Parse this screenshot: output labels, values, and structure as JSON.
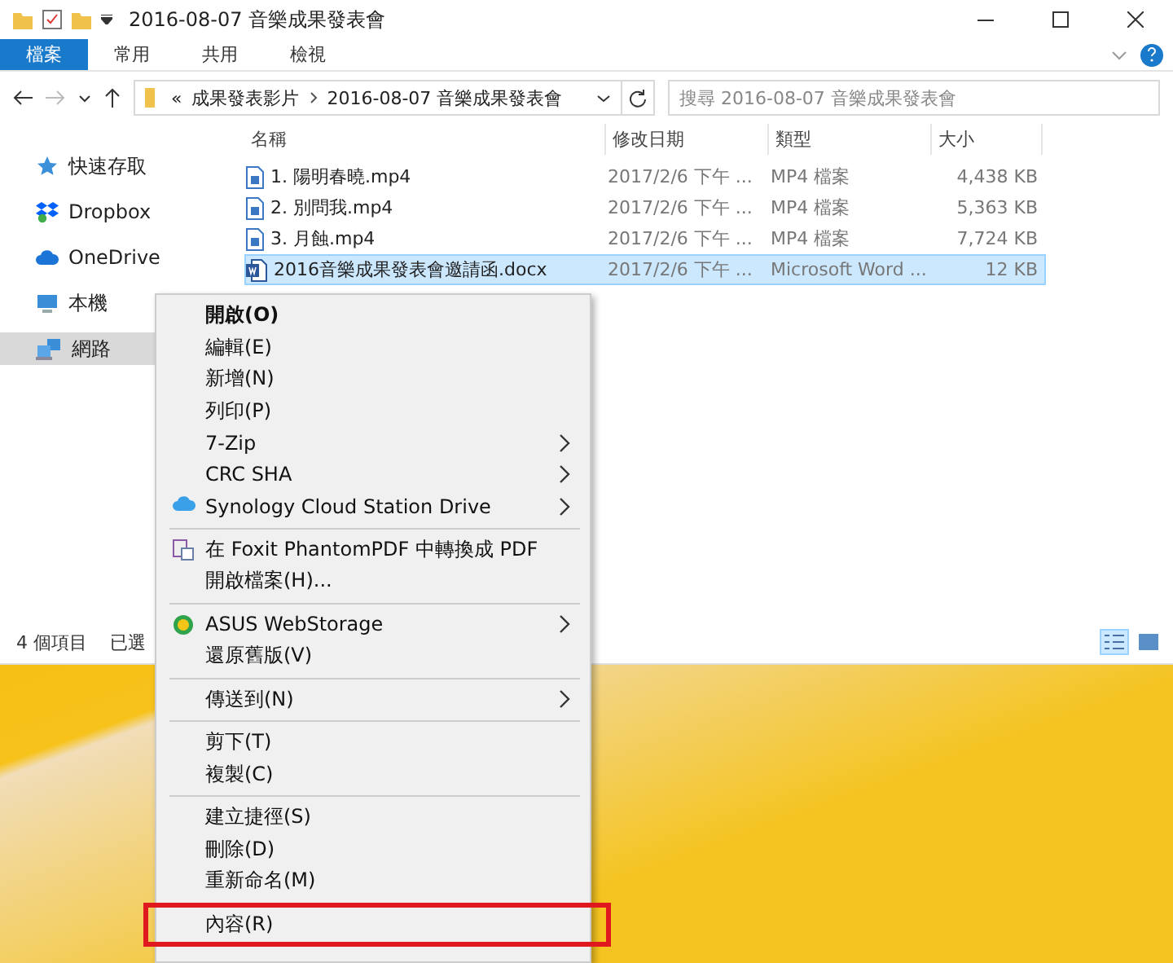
{
  "window": {
    "title": "2016-08-07 音樂成果發表會"
  },
  "ribbon_tabs": [
    {
      "label": "檔案",
      "selected": true
    },
    {
      "label": "常用",
      "selected": false
    },
    {
      "label": "共用",
      "selected": false
    },
    {
      "label": "檢視",
      "selected": false
    }
  ],
  "address": {
    "overflow": "«",
    "crumbs": [
      "成果發表影片",
      "2016-08-07 音樂成果發表會"
    ]
  },
  "search": {
    "placeholder": "搜尋 2016-08-07 音樂成果發表會"
  },
  "sidebar": {
    "items": [
      {
        "label": "快速存取",
        "kind": "star",
        "selected": false
      },
      {
        "label": "Dropbox",
        "kind": "box",
        "selected": false
      },
      {
        "label": "OneDrive",
        "kind": "cloud",
        "selected": false
      },
      {
        "label": "本機",
        "kind": "computer",
        "selected": false
      },
      {
        "label": "網路",
        "kind": "network",
        "selected": true
      }
    ]
  },
  "table": {
    "columns": [
      "名稱",
      "修改日期",
      "類型",
      "大小"
    ],
    "rows": [
      {
        "name": "1. 陽明春曉.mp4",
        "date": "2017/2/6 下午 ...",
        "type": "MP4 檔案",
        "size": "4,438 KB",
        "kind": "video",
        "selected": false
      },
      {
        "name": "2. 別問我.mp4",
        "date": "2017/2/6 下午 ...",
        "type": "MP4 檔案",
        "size": "5,363 KB",
        "kind": "video",
        "selected": false
      },
      {
        "name": "3. 月蝕.mp4",
        "date": "2017/2/6 下午 ...",
        "type": "MP4 檔案",
        "size": "7,724 KB",
        "kind": "video",
        "selected": false
      },
      {
        "name": "2016音樂成果發表會邀請函.docx",
        "date": "2017/2/6 下午 ...",
        "type": "Microsoft Word ...",
        "size": "12 KB",
        "kind": "word",
        "selected": true
      }
    ]
  },
  "status_bar": {
    "count": "4 個項目",
    "selection": "已選"
  },
  "context_menu": [
    {
      "kind": "item",
      "label": "開啟(O)",
      "bold": true
    },
    {
      "kind": "item",
      "label": "編輯(E)"
    },
    {
      "kind": "item",
      "label": "新增(N)"
    },
    {
      "kind": "item",
      "label": "列印(P)"
    },
    {
      "kind": "item",
      "label": "7-Zip",
      "submenu": true
    },
    {
      "kind": "item",
      "label": "CRC SHA",
      "submenu": true
    },
    {
      "kind": "cloud",
      "label": "Synology Cloud Station Drive",
      "submenu": true
    },
    {
      "kind": "separator"
    },
    {
      "kind": "document",
      "label": "在 Foxit PhantomPDF 中轉換成 PDF"
    },
    {
      "kind": "item",
      "label": "開啟檔案(H)..."
    },
    {
      "kind": "separator"
    },
    {
      "kind": "circle",
      "label": "ASUS WebStorage",
      "submenu": true
    },
    {
      "kind": "item",
      "label": "還原舊版(V)"
    },
    {
      "kind": "separator"
    },
    {
      "kind": "item",
      "label": "傳送到(N)",
      "submenu": true
    },
    {
      "kind": "separator"
    },
    {
      "kind": "item",
      "label": "剪下(T)"
    },
    {
      "kind": "item",
      "label": "複製(C)"
    },
    {
      "kind": "separator"
    },
    {
      "kind": "item",
      "label": "建立捷徑(S)"
    },
    {
      "kind": "item",
      "label": "刪除(D)"
    },
    {
      "kind": "item",
      "label": "重新命名(M)"
    },
    {
      "kind": "separator"
    },
    {
      "kind": "item",
      "label": "內容(R)",
      "highlighted": true
    }
  ]
}
